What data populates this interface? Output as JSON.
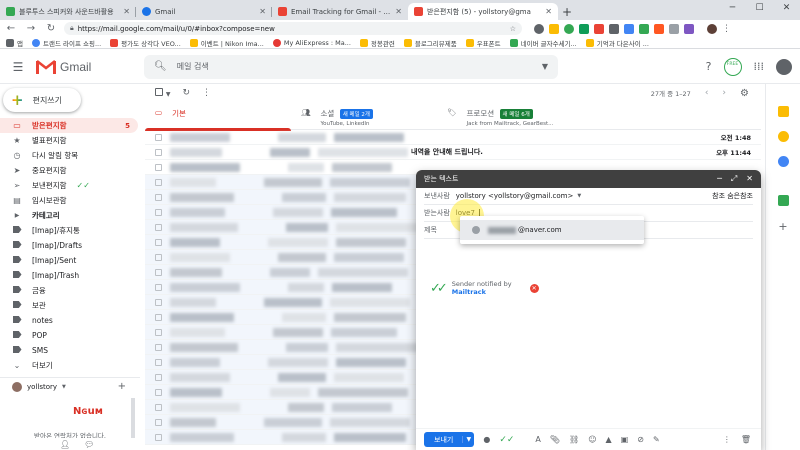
{
  "browser": {
    "tabs": [
      {
        "title": "블루투스 스피커와 사운드바활용",
        "color": "#34a853"
      },
      {
        "title": "Gmail",
        "color": "#1a73e8"
      },
      {
        "title": "Email Tracking for Gmail - Mailt",
        "color": "#ea4335"
      },
      {
        "title": "받은편지함 (5) - yollstory@gma",
        "color": "#ea4335"
      }
    ],
    "url": "https://mail.google.com/mail/u/0/#inbox?compose=new",
    "bookmarks": [
      {
        "label": "앱",
        "color": "#5f6368"
      },
      {
        "label": "트랜드 라이프 쇼핑...",
        "color": "#4285f4"
      },
      {
        "label": "평가도 상각다 VEO...",
        "color": "#ea4335"
      },
      {
        "label": "이벤트 | Nikon Ima...",
        "color": "#fbbc04"
      },
      {
        "label": "My AliExpress : Ma...",
        "color": "#e53935"
      },
      {
        "label": "정봉관련",
        "color": "#fbbc04"
      },
      {
        "label": "블로그리뷰제품",
        "color": "#fbbc04"
      },
      {
        "label": "우표폰트",
        "color": "#fbbc04"
      },
      {
        "label": "네이버 글자수세기...",
        "color": "#34a853"
      },
      {
        "label": "기억과 다은사이 ...",
        "color": "#fbbc04"
      }
    ]
  },
  "gmail": {
    "app_name": "Gmail",
    "search_placeholder": "메일 검색",
    "compose_label": "편지쓰기",
    "free_badge": "FREE",
    "nav": [
      {
        "label": "받은편지함",
        "count": "5",
        "icon": "inbox-icon",
        "active": true
      },
      {
        "label": "별표편지함",
        "count": "",
        "icon": "star-icon"
      },
      {
        "label": "다시 알림 항목",
        "count": "",
        "icon": "clock-icon"
      },
      {
        "label": "중요편지함",
        "count": "",
        "icon": "important-icon"
      },
      {
        "label": "보낸편지함",
        "count": "",
        "icon": "send-icon",
        "check": "✓✓"
      },
      {
        "label": "임시보관함",
        "count": "",
        "icon": "draft-icon"
      },
      {
        "label": "카테고리",
        "count": "",
        "icon": "category-icon"
      },
      {
        "label": "[Imap]/휴지통",
        "count": "",
        "icon": "label-icon"
      },
      {
        "label": "[Imap]/Drafts",
        "count": "",
        "icon": "label-icon"
      },
      {
        "label": "[Imap]/Sent",
        "count": "",
        "icon": "label-icon"
      },
      {
        "label": "[Imap]/Trash",
        "count": "",
        "icon": "label-icon"
      },
      {
        "label": "금융",
        "count": "",
        "icon": "label-icon"
      },
      {
        "label": "보관",
        "count": "",
        "icon": "label-icon"
      },
      {
        "label": "notes",
        "count": "",
        "icon": "label-icon"
      },
      {
        "label": "POP",
        "count": "",
        "icon": "label-icon"
      },
      {
        "label": "SMS",
        "count": "",
        "icon": "label-icon"
      },
      {
        "label": "더보기",
        "count": "",
        "icon": "expand-icon"
      }
    ],
    "hangouts": {
      "user": "yollstory",
      "brand": "Nɢuᴍ",
      "empty_text": "받아온 연락처가 없습니다."
    },
    "toolbar": {
      "paging": "27개 중 1–27"
    },
    "category_tabs": [
      {
        "label": "기본",
        "badge": "",
        "sub": ""
      },
      {
        "label": "소셜",
        "badge": "새 메일 2개",
        "sub": "YouTube, LinkedIn"
      },
      {
        "label": "프로모션",
        "badge": "새 메일 6개",
        "sub": "Jack from Mailtrack, GearBest..."
      }
    ],
    "mail_rows": [
      {
        "subject": "",
        "time": "오전 1:48"
      },
      {
        "subject": "내역을 안내해 드립니다.",
        "time": "오후 11:44"
      },
      {
        "subject": "",
        "time": ""
      },
      {
        "subject": "",
        "time": ""
      },
      {
        "subject": "",
        "time": ""
      },
      {
        "subject": "",
        "time": ""
      },
      {
        "subject": "",
        "time": ""
      },
      {
        "subject": "",
        "time": ""
      },
      {
        "subject": "",
        "time": ""
      },
      {
        "subject": "",
        "time": ""
      },
      {
        "subject": "",
        "time": ""
      },
      {
        "subject": "",
        "time": ""
      },
      {
        "subject": "",
        "time": ""
      },
      {
        "subject": "",
        "time": ""
      },
      {
        "subject": "",
        "time": ""
      },
      {
        "subject": "",
        "time": ""
      },
      {
        "subject": "",
        "time": ""
      },
      {
        "subject": "",
        "time": ""
      },
      {
        "subject": "",
        "time": ""
      },
      {
        "subject": "",
        "time": ""
      },
      {
        "subject": "",
        "time": ""
      }
    ]
  },
  "compose": {
    "title": "받는 텍스트",
    "from_label": "보낸사람",
    "from_value": "yollstory <yollstory@gmail.com>",
    "to_label": "받는사람",
    "to_value": "love7",
    "cc_bcc": "참조 숨은참조",
    "subject_label": "제목",
    "suggestion": "@naver.com",
    "notify_text": "Sender notified by",
    "notify_brand": "Mailtrack",
    "send_label": "보내기"
  }
}
